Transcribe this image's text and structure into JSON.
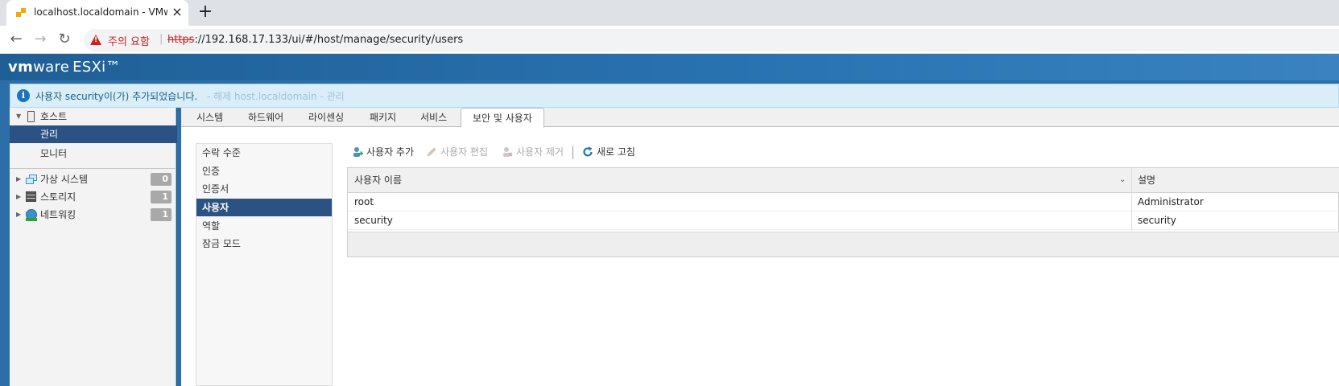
{
  "browser": {
    "tab_title": "localhost.localdomain - VMware",
    "tab_close": "×",
    "new_tab": "+",
    "back": "←",
    "forward": "→",
    "reload": "↻",
    "security_warning": "주의 요함",
    "separator": "|",
    "url_scheme": "https",
    "url_rest": "://192.168.17.133/ui/#/host/manage/security/users"
  },
  "header": {
    "logo_vm": "vm",
    "logo_ware": "ware",
    "product": "ESXi™"
  },
  "notification": {
    "icon": "i",
    "message": "사용자 security이(가) 추가되었습니다.",
    "ghost_text": "- 해제 host.localdomain - 관리"
  },
  "navigator": {
    "host_label": "호스트",
    "manage_label": "관리",
    "monitor_label": "모니터",
    "items": [
      {
        "label": "가상 시스템",
        "count": "0",
        "icon": "vm-icon"
      },
      {
        "label": "스토리지",
        "count": "1",
        "icon": "storage-icon"
      },
      {
        "label": "네트워킹",
        "count": "1",
        "icon": "network-icon"
      }
    ]
  },
  "tabs": {
    "system": "시스템",
    "hardware": "하드웨어",
    "licensing": "라이센싱",
    "packages": "패키지",
    "services": "서비스",
    "security_users": "보안 및 사용자"
  },
  "subnav": {
    "acceptance": "수락 수준",
    "authentication": "인증",
    "certificates": "인증서",
    "users": "사용자",
    "roles": "역할",
    "lockdown": "잠금 모드"
  },
  "actions": {
    "add_user": "사용자 추가",
    "edit_user": "사용자 편집",
    "remove_user": "사용자 제거",
    "refresh": "새로 고침"
  },
  "grid": {
    "col_username": "사용자 이름",
    "col_description": "설명",
    "rows": [
      {
        "username": "root",
        "description": "Administrator"
      },
      {
        "username": "security",
        "description": "security"
      }
    ]
  }
}
